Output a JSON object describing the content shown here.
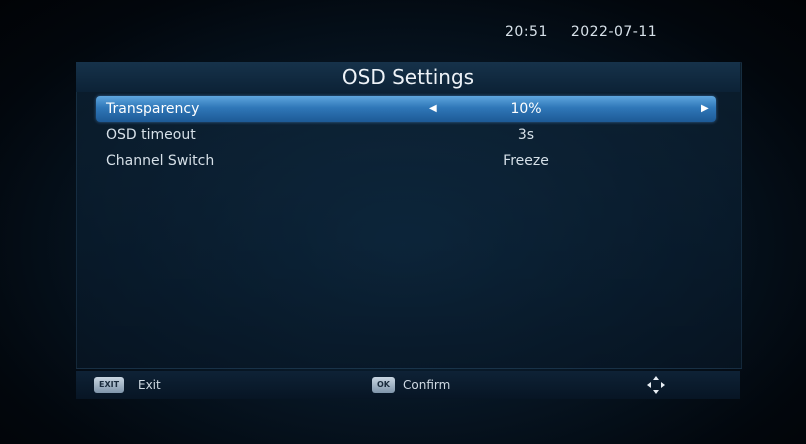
{
  "status": {
    "time": "20:51",
    "date": "2022-07-11"
  },
  "menu": {
    "title": "OSD Settings",
    "rows": [
      {
        "label": "Transparency",
        "value": "10%"
      },
      {
        "label": "OSD timeout",
        "value": "3s"
      },
      {
        "label": "Channel Switch",
        "value": "Freeze"
      }
    ]
  },
  "footer": {
    "exit_key": "EXIT",
    "exit_label": "Exit",
    "ok_key": "OK",
    "ok_label": "Confirm",
    "nav_icon": "direction-pad-icon"
  },
  "colors": {
    "selection": "#2f77b8",
    "text": "#e6eef5"
  }
}
